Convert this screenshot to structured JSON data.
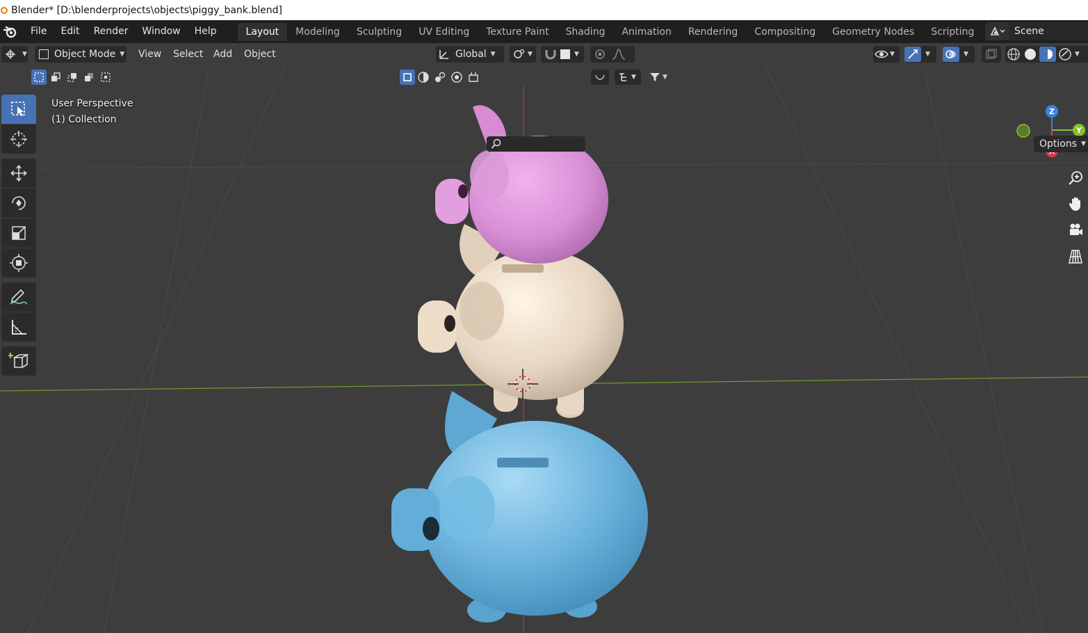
{
  "window": {
    "title": "Blender* [D:\\blenderprojects\\objects\\piggy_bank.blend]"
  },
  "menu": [
    "File",
    "Edit",
    "Render",
    "Window",
    "Help"
  ],
  "workspaces": [
    "Layout",
    "Modeling",
    "Sculpting",
    "UV Editing",
    "Texture Paint",
    "Shading",
    "Animation",
    "Rendering",
    "Compositing",
    "Geometry Nodes",
    "Scripting"
  ],
  "active_workspace": "Layout",
  "scene": {
    "name": "Scene"
  },
  "viewport_header": {
    "mode": "Object Mode",
    "menus": [
      "View",
      "Select",
      "Add",
      "Object"
    ],
    "transform_orientation": "Global",
    "options_label": "Options"
  },
  "overlay": {
    "line1": "User Perspective",
    "line2": "(1) Collection"
  },
  "gizmo": {
    "x": "X",
    "y": "Y",
    "z": "Z"
  },
  "colors": {
    "accent": "#4772b3",
    "pig_pink": "#d98fd6",
    "pig_cream": "#e8d9c6",
    "pig_blue": "#6bb3dd",
    "x_axis": "#e0364a",
    "y_axis": "#86c135",
    "z_axis": "#3a82e0"
  },
  "icons": [
    "blender-logo-icon",
    "select-box-icon",
    "cursor-icon",
    "move-icon",
    "rotate-icon",
    "scale-icon",
    "transform-icon",
    "annotate-icon",
    "measure-icon",
    "add-cube-icon",
    "zoom-icon",
    "hand-pan-icon",
    "camera-icon",
    "grid-view-icon"
  ]
}
